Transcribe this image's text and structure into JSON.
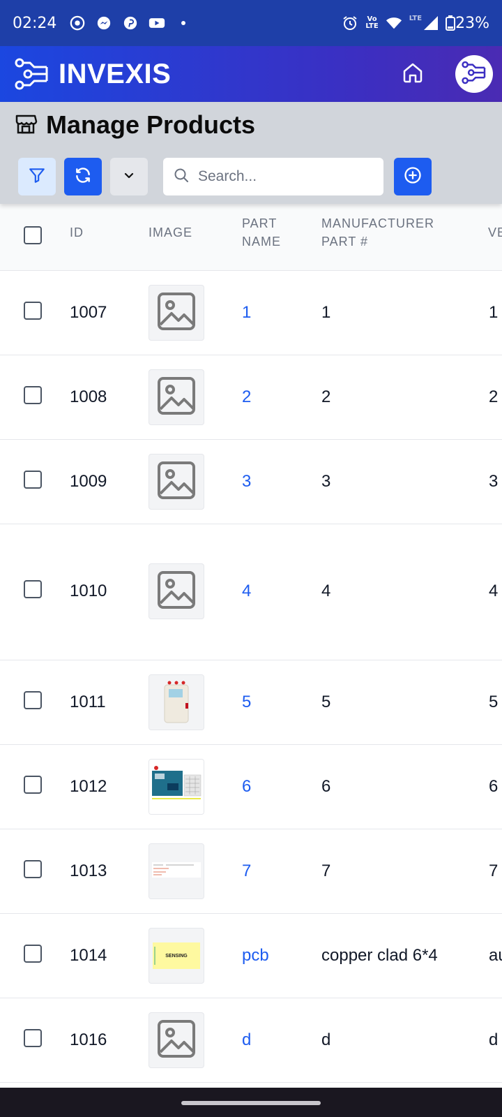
{
  "status_bar": {
    "time": "02:24",
    "battery": "23%",
    "network_label_top": "Vo",
    "network_label_bottom": "LTE",
    "lte_label": "LTE",
    "icons": [
      "chrome-icon",
      "messenger-icon",
      "pinterest-icon",
      "youtube-icon",
      "dot-icon",
      "alarm-icon",
      "volte-icon",
      "wifi-icon",
      "signal-icon",
      "battery-icon"
    ]
  },
  "app": {
    "title": "INVEXIS",
    "icons": [
      "invexis-logo-icon",
      "home-icon",
      "avatar-logo-icon"
    ]
  },
  "page": {
    "title": "Manage Products",
    "title_icon": "store-icon"
  },
  "toolbar": {
    "search_placeholder": "Search...",
    "icons": [
      "filter-icon",
      "refresh-icon",
      "chevron-down-icon",
      "search-icon",
      "plus-circle-icon"
    ]
  },
  "table": {
    "headers": {
      "id": "ID",
      "image": "IMAGE",
      "part_name": "PART\nNAME",
      "manufacturer_part": "MANUFACTURER\nPART #",
      "next_col": "VE"
    },
    "rows": [
      {
        "id": "1007",
        "image": "placeholder",
        "part_name": "1",
        "manufacturer_part": "1",
        "next_col": "1"
      },
      {
        "id": "1008",
        "image": "placeholder",
        "part_name": "2",
        "manufacturer_part": "2",
        "next_col": "2"
      },
      {
        "id": "1009",
        "image": "placeholder",
        "part_name": "3",
        "manufacturer_part": "3",
        "next_col": "3"
      },
      {
        "id": "1010",
        "image": "placeholder",
        "part_name": "4",
        "manufacturer_part": "4",
        "next_col": "4"
      },
      {
        "id": "1011",
        "image": "device-photo",
        "part_name": "5",
        "manufacturer_part": "5",
        "next_col": "5"
      },
      {
        "id": "1012",
        "image": "circuit-photo",
        "part_name": "6",
        "manufacturer_part": "6",
        "next_col": "6"
      },
      {
        "id": "1013",
        "image": "document-photo",
        "part_name": "7",
        "manufacturer_part": "7",
        "next_col": "7"
      },
      {
        "id": "1014",
        "image": "label-photo",
        "image_text": "SENSING",
        "part_name": "pcb",
        "manufacturer_part": "copper clad 6*4",
        "next_col": "au"
      },
      {
        "id": "1016",
        "image": "placeholder",
        "part_name": "d",
        "manufacturer_part": "d",
        "next_col": "d"
      }
    ]
  },
  "colors": {
    "status_bar": "#1e3fa8",
    "header_gradient_start": "#1b47e0",
    "header_gradient_end": "#4a2bb3",
    "primary": "#1d5cf0",
    "page_header_bg": "#d1d5db",
    "link": "#1d5cf0"
  }
}
